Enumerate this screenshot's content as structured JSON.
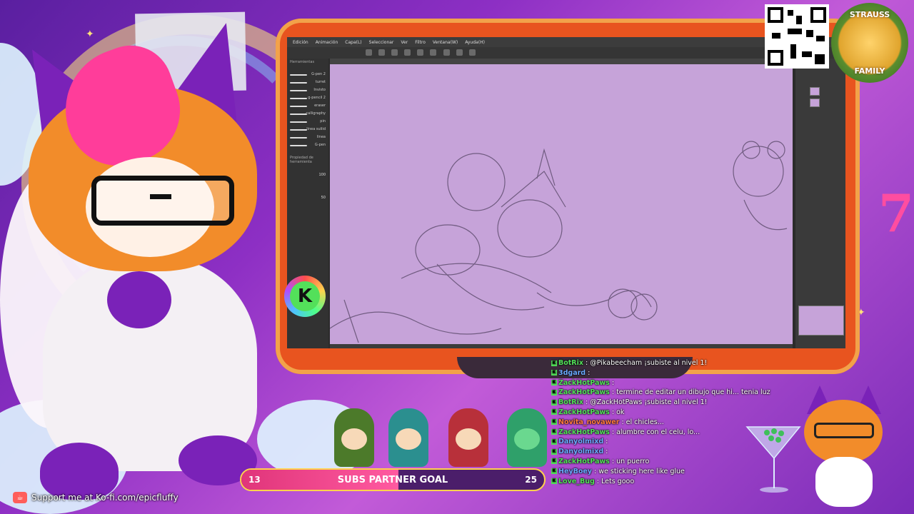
{
  "app": {
    "menu": [
      "Edición",
      "Animación",
      "Capa(L)",
      "Seleccionar",
      "Ver",
      "Filtro",
      "Ventana(W)",
      "Ayuda(H)"
    ],
    "brushes": [
      "G-pen 2",
      "turret",
      "Invisto",
      "g-pencil 2",
      "eraser",
      "calligraphy",
      "pin",
      "linea suliid",
      "linea",
      "G-pen"
    ],
    "left_panel_title": "Herramientas",
    "brush_properties_title": "Propiedad de herramienta",
    "brush_size_value": "100",
    "brush_size_value2": "50"
  },
  "stream": {
    "kofi_text": "Support me at Ko-fi.com/epicfluffy",
    "badge_letter": "K",
    "family_badge_top": "STRAUSS",
    "family_badge_bottom": "FAMILY",
    "number_deco": "7"
  },
  "goal": {
    "current": "13",
    "target": "25",
    "label": "SUBS PARTNER GOAL",
    "progress_fraction": 0.52
  },
  "chat": [
    {
      "user": "BotRix",
      "message": ": @Pikabeecham ¡subiste al nivel 1!",
      "user_color": "#53e05a"
    },
    {
      "user": "3dgard",
      "message": ":",
      "user_color": "#6aa9ff"
    },
    {
      "user": "ZackHotPaws",
      "message": ":",
      "user_color": "#53e05a"
    },
    {
      "user": "ZackHotPaws",
      "message": ": termine de editar un dibujo que hi... tenia luz",
      "user_color": "#53e05a"
    },
    {
      "user": "BotRix",
      "message": ": @ZackHotPaws ¡subiste al nivel 1!",
      "user_color": "#53e05a"
    },
    {
      "user": "ZackHotPaws",
      "message": ": ok",
      "user_color": "#53e05a"
    },
    {
      "user": "Novita_novawer",
      "message": ": el chicles...",
      "user_color": "#ff7a3c"
    },
    {
      "user": "ZackHotPaws",
      "message": ": alumbre con el celu, lo...",
      "user_color": "#53e05a"
    },
    {
      "user": "Danyolmixd",
      "message": ":",
      "user_color": "#6aa9ff"
    },
    {
      "user": "Danyolmixd",
      "message": ":",
      "user_color": "#6aa9ff"
    },
    {
      "user": "ZackHotPaws",
      "message": ": un puerro",
      "user_color": "#53e05a"
    },
    {
      "user": "HeyBoey",
      "message": ": we sticking here like glue",
      "user_color": "#6aa9ff"
    },
    {
      "user": "Love_Bug",
      "message": ": Lets gooo",
      "user_color": "#53e05a"
    }
  ],
  "colors": {
    "canvas": "#c6a3d9",
    "monitor": "#e8541f",
    "goal_fill": "#e0357a",
    "accent_green": "#53e05a"
  }
}
